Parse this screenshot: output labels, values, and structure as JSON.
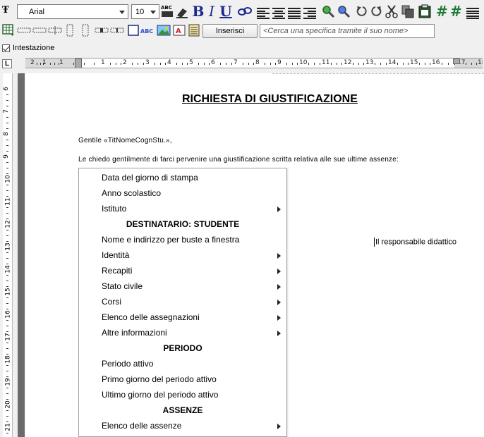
{
  "toolbar": {
    "font_name": "Arial",
    "font_size": "10",
    "insert_label": "Inserisci",
    "search_placeholder": "<Cerca una specifica tramite il suo nome>"
  },
  "header_checkbox": {
    "label": "Intestazione",
    "checked": true
  },
  "ruler": {
    "h_numbers": [
      "2",
      "1",
      "1",
      "1",
      "2",
      "3",
      "4",
      "5",
      "6",
      "7",
      "8",
      "9",
      "10",
      "11",
      "12",
      "13",
      "14",
      "15",
      "16",
      "17",
      "18"
    ],
    "v_numbers": [
      "6",
      "7",
      "8",
      "9",
      "10",
      "11",
      "12",
      "13",
      "14",
      "15",
      "16",
      "17",
      "18",
      "19",
      "20",
      "21"
    ]
  },
  "document": {
    "title": "RICHIESTA DI GIUSTIFICAZIONE",
    "greeting": "Gentile «TitNomeCognStu.»,",
    "body": "Le chiedo gentilmente di farci pervenire una giustificazione scritta relativa alle sue ultime assenze:",
    "signature": "Il responsabile didattico"
  },
  "menu": {
    "items": [
      {
        "type": "item",
        "label": "Data del giorno di stampa",
        "submenu": false
      },
      {
        "type": "item",
        "label": "Anno scolastico",
        "submenu": false
      },
      {
        "type": "item",
        "label": "Istituto",
        "submenu": true
      },
      {
        "type": "header",
        "label": "DESTINATARIO: STUDENTE"
      },
      {
        "type": "item",
        "label": "Nome e indirizzo per buste a finestra",
        "submenu": false
      },
      {
        "type": "item",
        "label": "Identità",
        "submenu": true
      },
      {
        "type": "item",
        "label": "Recapiti",
        "submenu": true
      },
      {
        "type": "item",
        "label": "Stato civile",
        "submenu": true
      },
      {
        "type": "item",
        "label": "Corsi",
        "submenu": true
      },
      {
        "type": "item",
        "label": "Elenco delle assegnazioni",
        "submenu": true
      },
      {
        "type": "item",
        "label": "Altre informazioni",
        "submenu": true
      },
      {
        "type": "header",
        "label": "PERIODO"
      },
      {
        "type": "item",
        "label": "Periodo attivo",
        "submenu": false
      },
      {
        "type": "item",
        "label": "Primo giorno del periodo attivo",
        "submenu": false
      },
      {
        "type": "item",
        "label": "Ultimo giorno del periodo attivo",
        "submenu": false
      },
      {
        "type": "header",
        "label": "ASSENZE"
      },
      {
        "type": "item",
        "label": "Elenco delle assenze",
        "submenu": true
      }
    ]
  },
  "colors": {
    "format_blue": "#1c2a8a",
    "hash_green": "#1e7a34",
    "page_bg": "#ffffff",
    "chrome_bg": "#f0f0f0"
  }
}
